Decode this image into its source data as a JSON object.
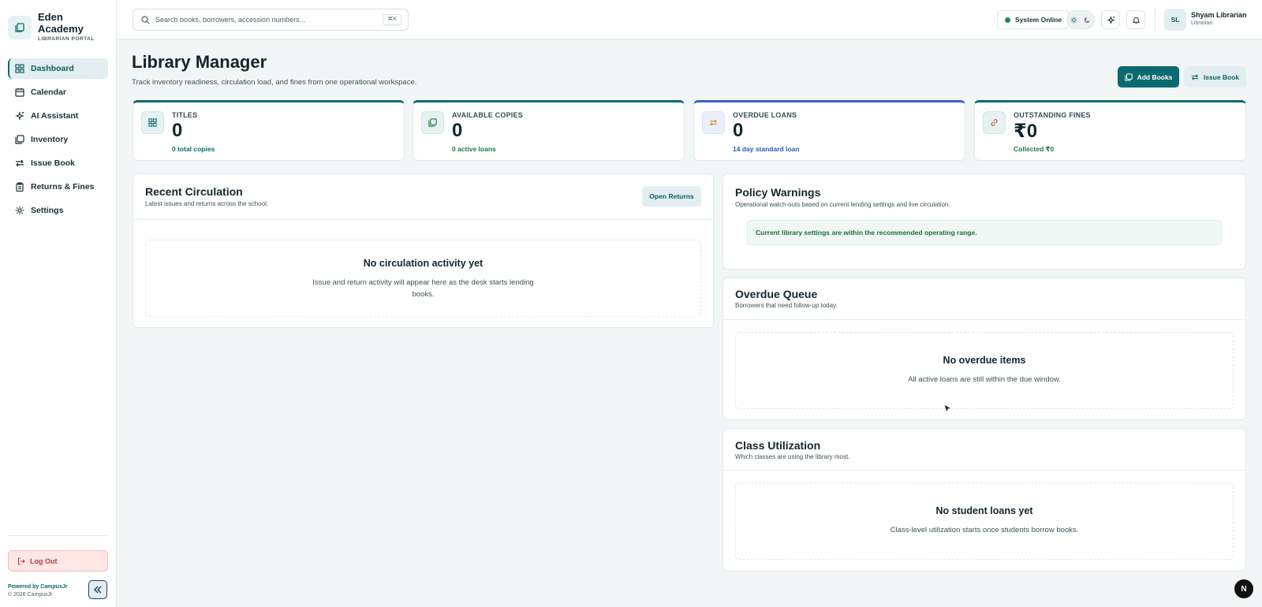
{
  "brand": {
    "name_line1": "Eden",
    "name_line2": "Academy",
    "subtitle": "LIBRARIAN PORTAL"
  },
  "sidebar": {
    "items": [
      {
        "label": "Dashboard",
        "icon": "grid-icon",
        "active": true
      },
      {
        "label": "Calendar",
        "icon": "calendar-icon"
      },
      {
        "label": "AI Assistant",
        "icon": "sparkles-icon"
      },
      {
        "label": "Inventory",
        "icon": "books-icon"
      },
      {
        "label": "Issue Book",
        "icon": "swap-arrows-icon"
      },
      {
        "label": "Returns & Fines",
        "icon": "clipboard-icon"
      },
      {
        "label": "Settings",
        "icon": "gear-icon"
      }
    ],
    "logout_label": "Log Out",
    "powered_by": "Powered by CampusJr",
    "copyright": "© 2026 CampusJr"
  },
  "topbar": {
    "search_placeholder": "Search books, borrowers, accession numbers...",
    "search_shortcut": "⌘K",
    "status": "System Online",
    "user_initials": "SL",
    "user_name": "Shyam Librarian",
    "user_role": "Librarian"
  },
  "header": {
    "title": "Library Manager",
    "subtitle": "Track inventory readiness, circulation load, and fines from one operational workspace.",
    "add_books_label": "Add Books",
    "issue_book_label": "Issue Book"
  },
  "stats": [
    {
      "label": "TITLES",
      "value": "0",
      "foot": "0 total copies",
      "icon": "grid-icon"
    },
    {
      "label": "AVAILABLE COPIES",
      "value": "0",
      "foot": "0 active loans",
      "icon": "books-icon"
    },
    {
      "label": "OVERDUE LOANS",
      "value": "0",
      "foot": "14 day standard loan",
      "icon": "swap-arrows-icon"
    },
    {
      "label": "OUTSTANDING FINES",
      "value": "₹0",
      "foot": "Collected ₹0",
      "icon": "link-icon"
    }
  ],
  "recent_circulation": {
    "title": "Recent Circulation",
    "subtitle": "Latest issues and returns across the school.",
    "button": "Open Returns",
    "empty_title": "No circulation activity yet",
    "empty_text": "Issue and return activity will appear here as the desk starts lending books."
  },
  "policy_warnings": {
    "title": "Policy Warnings",
    "subtitle": "Operational watch-outs based on current lending settings and live circulation.",
    "message": "Current library settings are within the recommended operating range."
  },
  "overdue_queue": {
    "title": "Overdue Queue",
    "subtitle": "Borrowers that need follow-up today.",
    "empty_title": "No overdue items",
    "empty_text": "All active loans are still within the due window."
  },
  "class_utilization": {
    "title": "Class Utilization",
    "subtitle": "Which classes are using the library most.",
    "empty_title": "No student loans yet",
    "empty_text": "Class-level utilization starts once students borrow books."
  },
  "dev_badge": "N",
  "colors": {
    "accent": "#0b6a70",
    "danger": "#c23b3b",
    "online": "#1b8a4b",
    "blue": "#3c5fcf"
  }
}
